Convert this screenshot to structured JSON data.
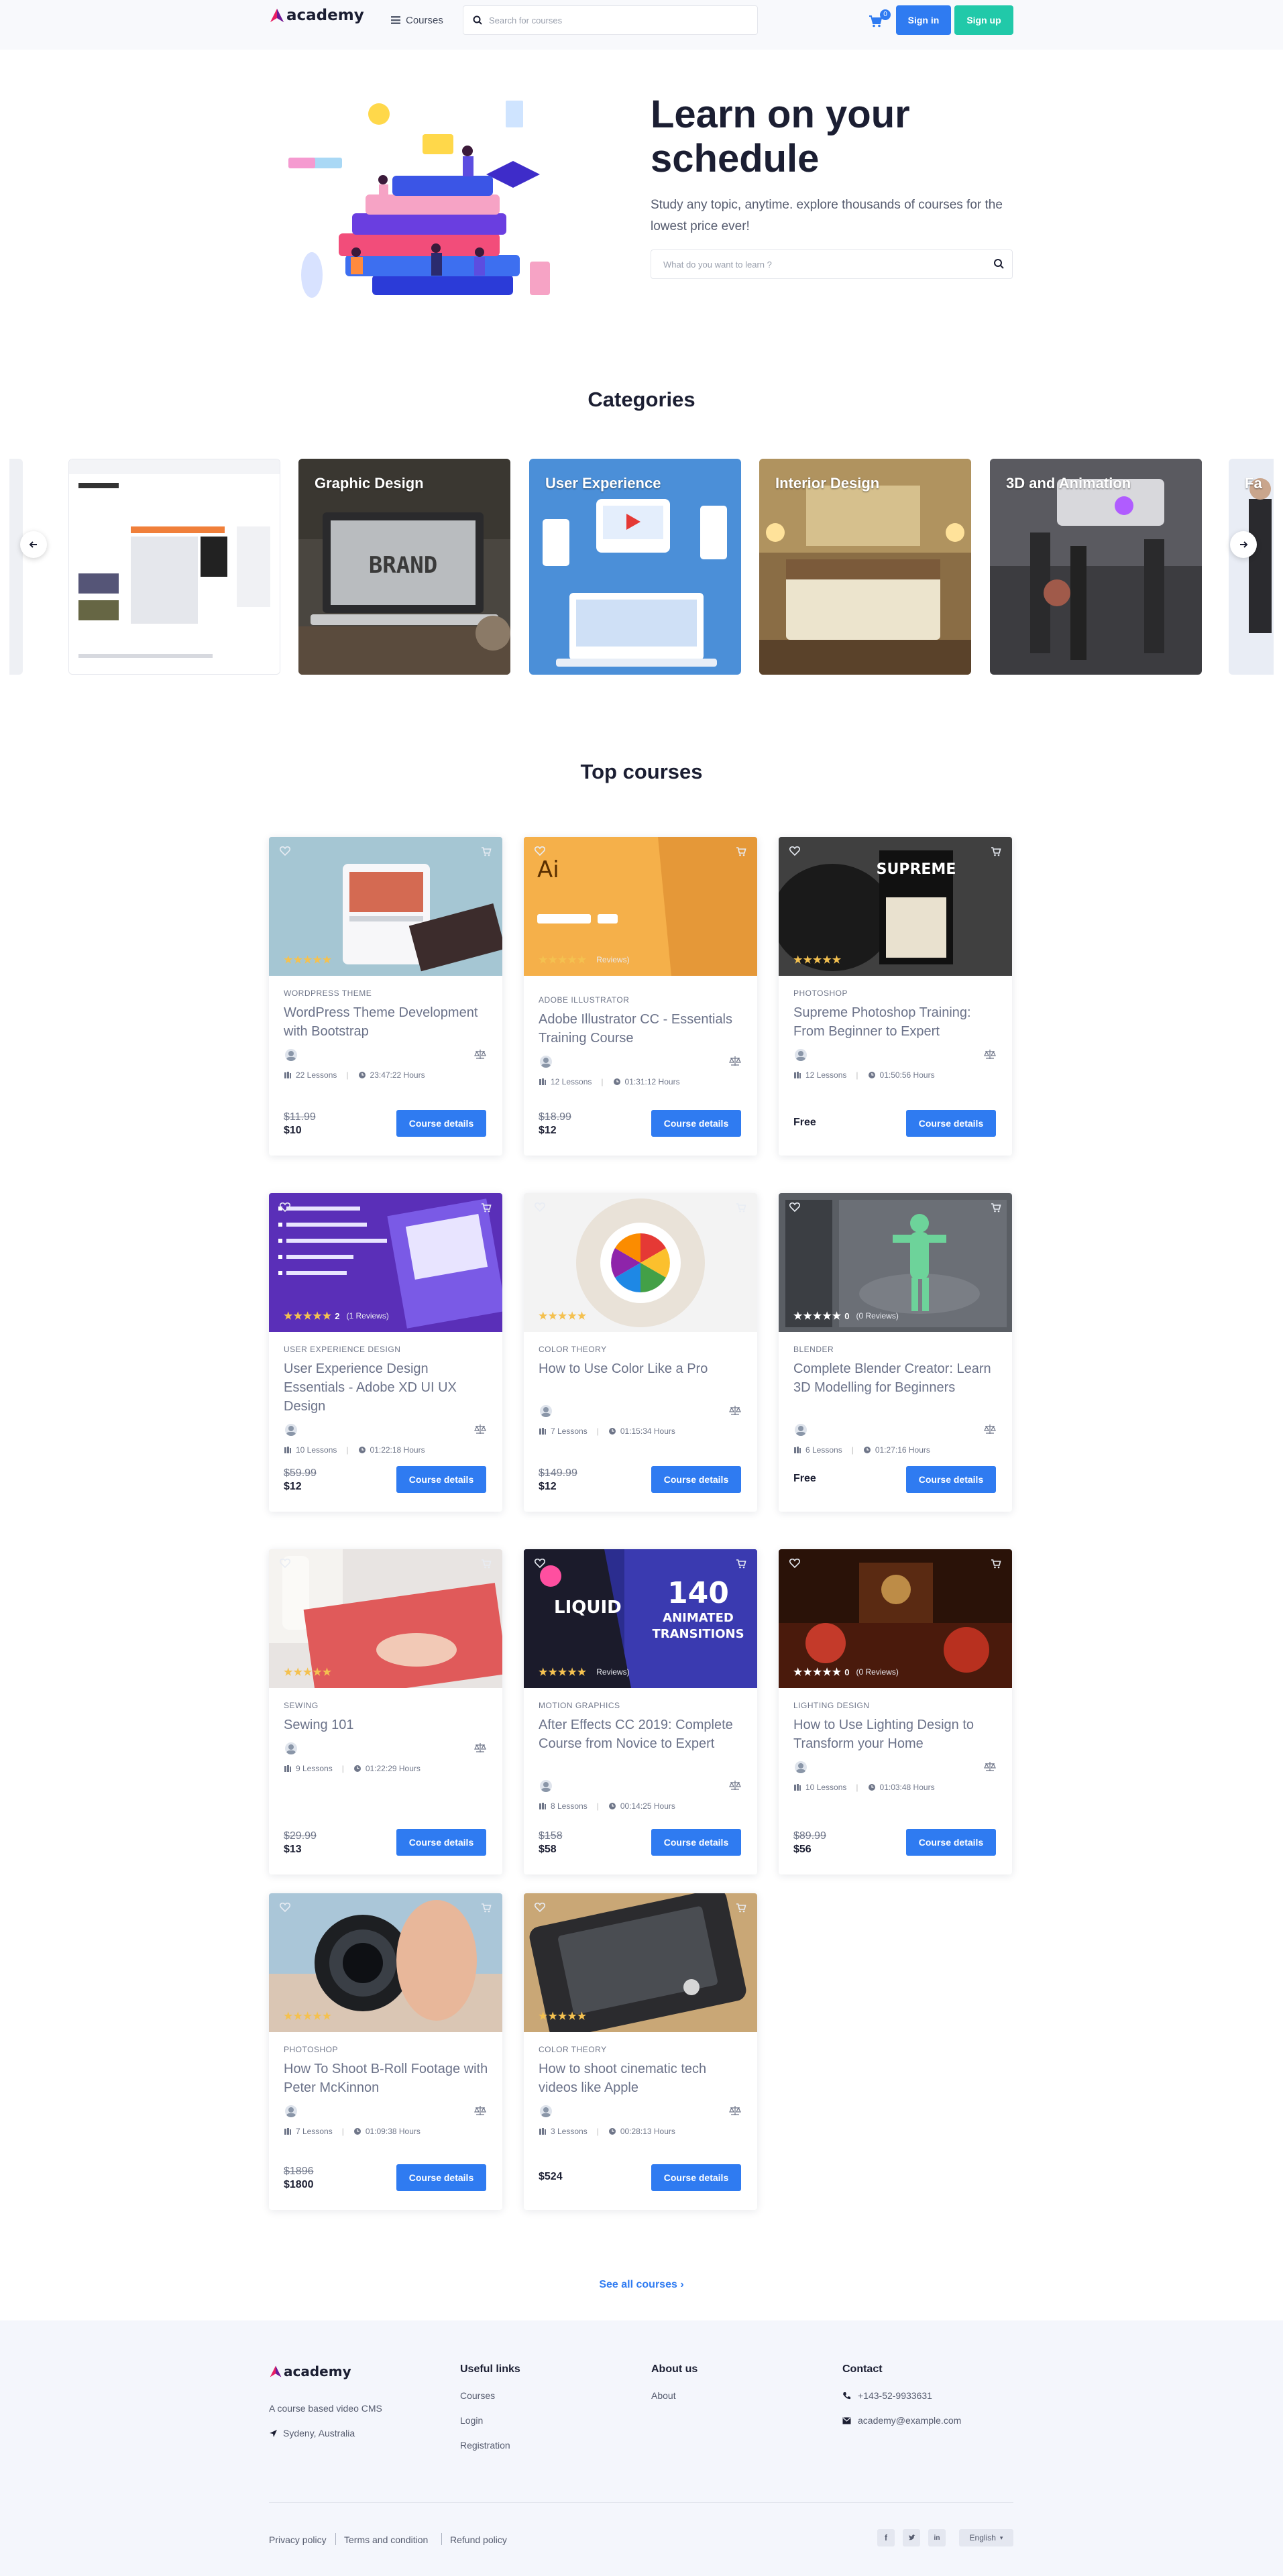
{
  "header": {
    "logo_text": "academy",
    "courses_label": "Courses",
    "search_placeholder": "Search for courses",
    "cart_count": "0",
    "signin_label": "Sign in",
    "signup_label": "Sign up"
  },
  "hero": {
    "title": "Learn on your schedule",
    "subtitle": "Study any topic, anytime. explore thousands of courses for the lowest price ever!",
    "search_placeholder": "What do you want to learn ?"
  },
  "categories": {
    "title": "Categories",
    "items": [
      {
        "label": ""
      },
      {
        "label": "Graphic Design"
      },
      {
        "label": "User Experience"
      },
      {
        "label": "Interior Design"
      },
      {
        "label": "3D and Animation"
      },
      {
        "label": "Fa"
      }
    ]
  },
  "top_courses": {
    "title": "Top courses",
    "cards": [
      {
        "category": "WORDPRESS THEME",
        "title": "WordPress Theme Development with Bootstrap",
        "lessons": "22 Lessons",
        "hours": "23:47:22 Hours",
        "old_price": "$11.99",
        "price": "$10",
        "rating": "",
        "reviews": "",
        "button": "Course details"
      },
      {
        "category": "ADOBE ILLUSTRATOR",
        "title": "Adobe Illustrator CC - Essentials Training Course",
        "lessons": "12 Lessons",
        "hours": "01:31:12 Hours",
        "old_price": "$18.99",
        "price": "$12",
        "rating": "",
        "reviews": "Reviews)",
        "button": "Course details"
      },
      {
        "category": "PHOTOSHOP",
        "title": "Supreme Photoshop Training: From Beginner to Expert",
        "lessons": "12 Lessons",
        "hours": "01:50:56 Hours",
        "old_price": "",
        "price": "Free",
        "rating": "",
        "reviews": "",
        "button": "Course details"
      },
      {
        "category": "USER EXPERIENCE DESIGN",
        "title": "User Experience Design Essentials - Adobe XD UI UX Design",
        "lessons": "10 Lessons",
        "hours": "01:22:18 Hours",
        "old_price": "$59.99",
        "price": "$12",
        "rating": "2",
        "reviews": "(1 Reviews)",
        "button": "Course details"
      },
      {
        "category": "COLOR THEORY",
        "title": "How to Use Color Like a Pro",
        "lessons": "7 Lessons",
        "hours": "01:15:34 Hours",
        "old_price": "$149.99",
        "price": "$12",
        "rating": "",
        "reviews": "",
        "button": "Course details"
      },
      {
        "category": "BLENDER",
        "title": "Complete Blender Creator: Learn 3D Modelling for Beginners",
        "lessons": "6 Lessons",
        "hours": "01:27:16 Hours",
        "old_price": "",
        "price": "Free",
        "rating": "0",
        "reviews": "(0 Reviews)",
        "button": "Course details"
      },
      {
        "category": "SEWING",
        "title": "Sewing 101",
        "lessons": "9 Lessons",
        "hours": "01:22:29 Hours",
        "old_price": "$29.99",
        "price": "$13",
        "rating": "",
        "reviews": "",
        "button": "Course details"
      },
      {
        "category": "MOTION GRAPHICS",
        "title": "After Effects CC 2019: Complete Course from Novice to Expert",
        "lessons": "8 Lessons",
        "hours": "00:14:25 Hours",
        "old_price": "$158",
        "price": "$58",
        "rating": "",
        "reviews": "Reviews)",
        "button": "Course details"
      },
      {
        "category": "LIGHTING DESIGN",
        "title": "How to Use Lighting Design to Transform your Home",
        "lessons": "10 Lessons",
        "hours": "01:03:48 Hours",
        "old_price": "$89.99",
        "price": "$56",
        "rating": "0",
        "reviews": "(0 Reviews)",
        "button": "Course details"
      },
      {
        "category": "PHOTOSHOP",
        "title": "How To Shoot B-Roll Footage with Peter McKinnon",
        "lessons": "7 Lessons",
        "hours": "01:09:38 Hours",
        "old_price": "$1896",
        "price": "$1800",
        "rating": "",
        "reviews": "",
        "button": "Course details"
      },
      {
        "category": "COLOR THEORY",
        "title": "How to shoot cinematic tech videos like Apple",
        "lessons": "3 Lessons",
        "hours": "00:28:13 Hours",
        "old_price": "",
        "price": "$524",
        "rating": "",
        "reviews": "",
        "button": "Course details"
      }
    ],
    "see_all": "See all courses"
  },
  "footer": {
    "logo_text": "academy",
    "tagline": "A course based video CMS",
    "location": "Sydeny, Australia",
    "useful_links_title": "Useful links",
    "useful_links": [
      "Courses",
      "Login",
      "Registration"
    ],
    "about_title": "About us",
    "about_links": [
      "About"
    ],
    "contact_title": "Contact",
    "phone": "+143-52-9933631",
    "email": "academy@example.com",
    "bottom_links": [
      "Privacy policy",
      "Terms and condition",
      "Refund policy"
    ],
    "language": "English"
  }
}
